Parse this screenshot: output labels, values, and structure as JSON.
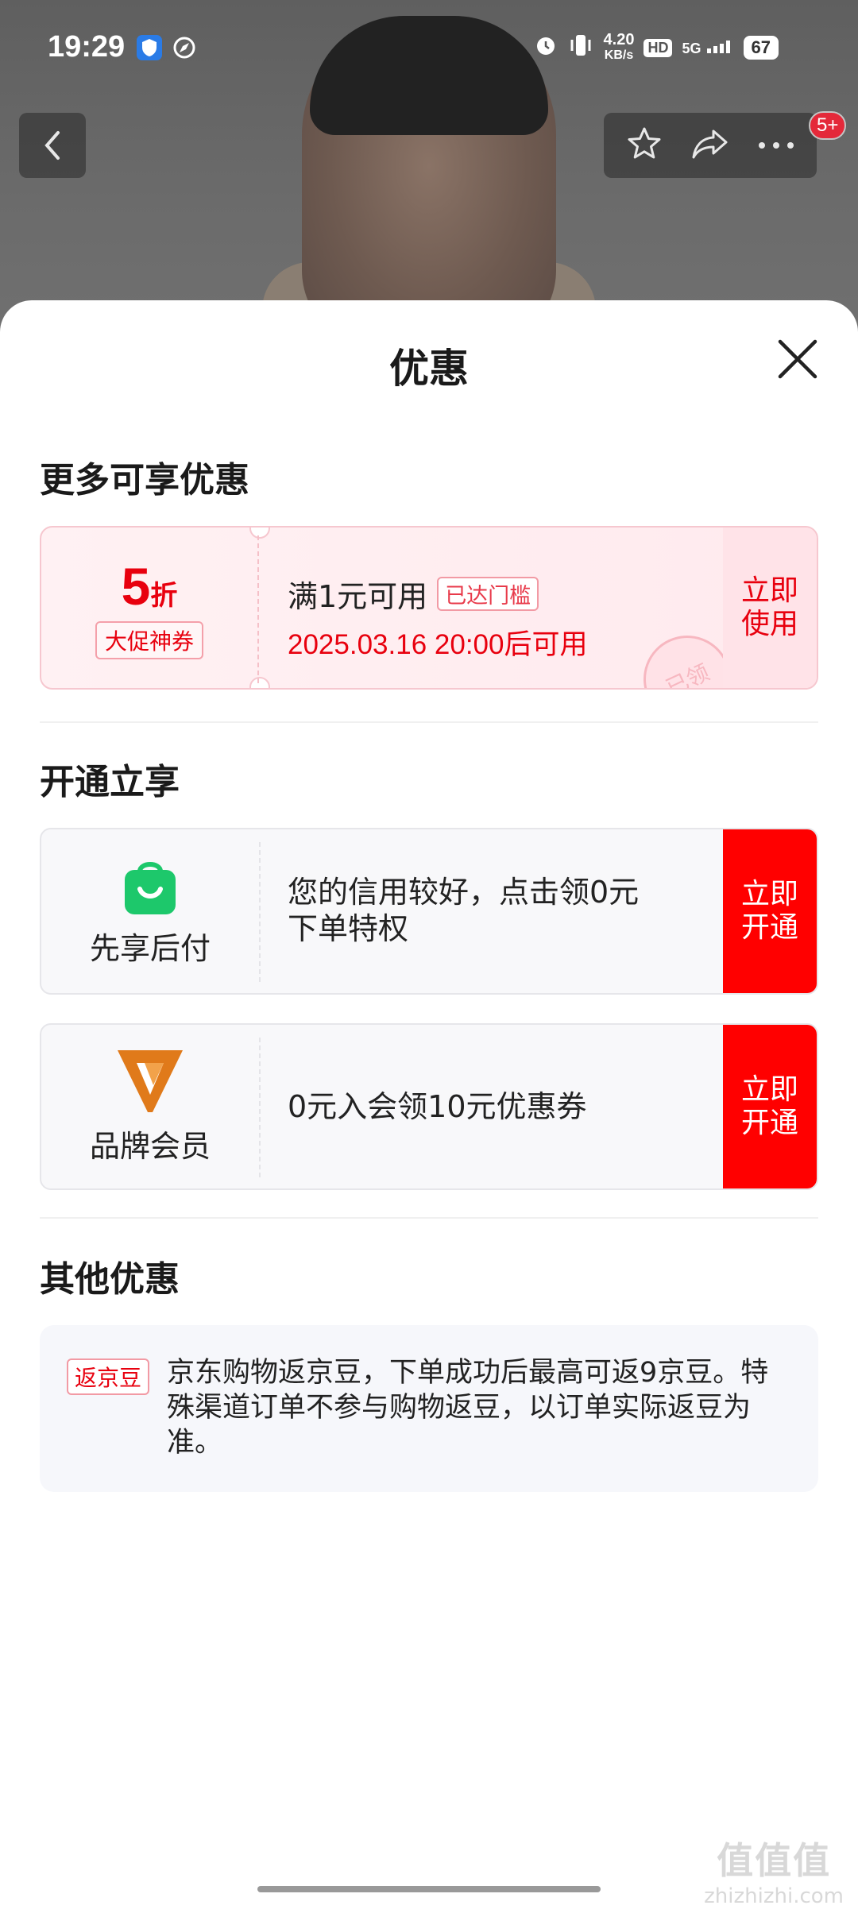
{
  "status_bar": {
    "time": "19:29",
    "net_speed_value": "4.20",
    "net_speed_unit": "KB/s",
    "hd": "HD",
    "network": "5G",
    "battery": "67"
  },
  "header": {
    "cart_badge": "5+"
  },
  "sheet": {
    "title": "优惠"
  },
  "sections": {
    "more_title": "更多可享优惠",
    "open_title": "开通立享",
    "other_title": "其他优惠"
  },
  "coupon": {
    "discount_num": "5",
    "discount_unit": "折",
    "tag": "大促神券",
    "condition": "满1元可用",
    "reached": "已达门槛",
    "date": "2025.03.16 20:00后可用",
    "stamp": "已领",
    "action_line1": "立即",
    "action_line2": "使用"
  },
  "services": [
    {
      "name": "先享后付",
      "desc_line1": "您的信用较好，点击领0元",
      "desc_line2": "下单特权",
      "action_line1": "立即",
      "action_line2": "开通"
    },
    {
      "name": "品牌会员",
      "desc_line1": "0元入会领10元优惠券",
      "action_line1": "立即",
      "action_line2": "开通"
    }
  ],
  "other": {
    "tag": "返京豆",
    "text": "京东购物返京豆，下单成功后最高可返9京豆。特殊渠道订单不参与购物返豆，以订单实际返豆为准。"
  },
  "watermark": {
    "big": "值值值",
    "small": "zhizhizhi.com"
  },
  "colors": {
    "accent": "#e8000e",
    "action_red": "#ff0000",
    "bag_green": "#1dc86b",
    "member_orange": "#e07a1a"
  }
}
